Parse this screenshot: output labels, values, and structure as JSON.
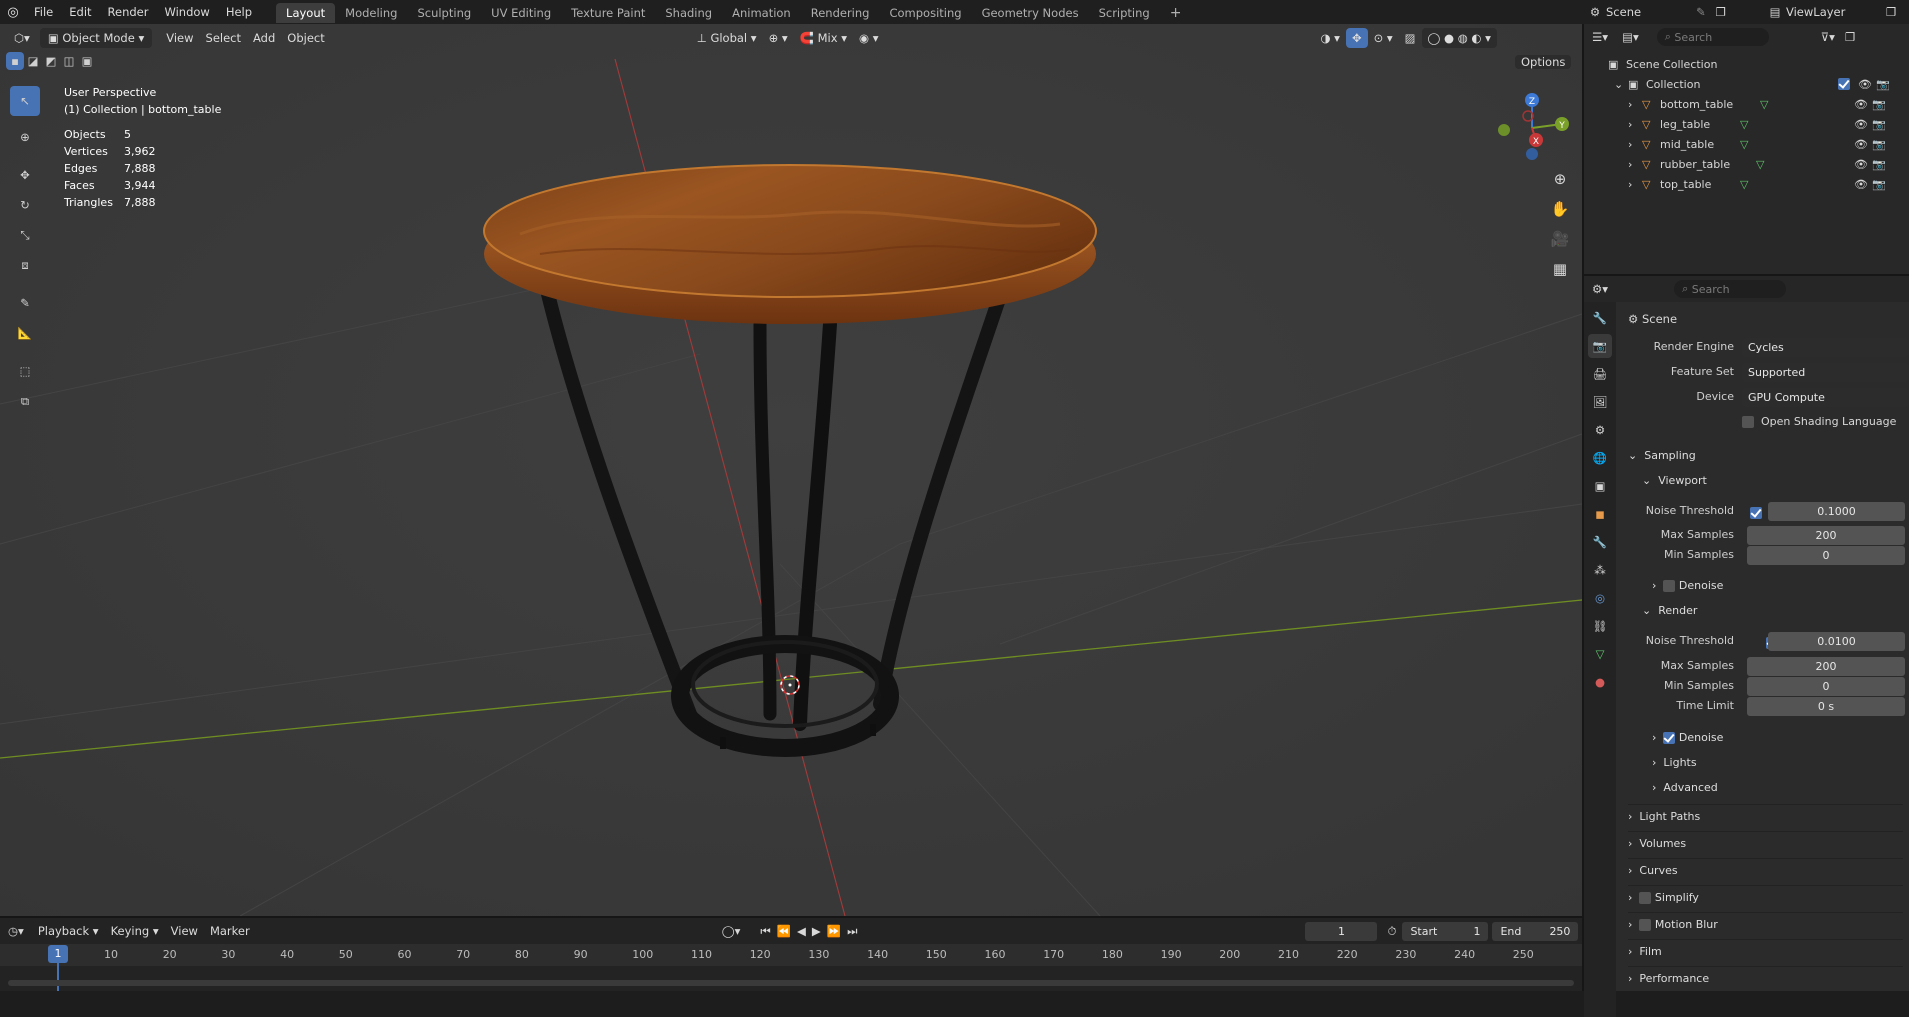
{
  "topbar": {
    "menus": [
      "File",
      "Edit",
      "Render",
      "Window",
      "Help"
    ],
    "workspaces": [
      "Layout",
      "Modeling",
      "Sculpting",
      "UV Editing",
      "Texture Paint",
      "Shading",
      "Animation",
      "Rendering",
      "Compositing",
      "Geometry Nodes",
      "Scripting"
    ],
    "active_workspace": "Layout",
    "add_tab": "+",
    "scene_name": "Scene",
    "view_layer": "ViewLayer"
  },
  "viewport_header": {
    "mode": "Object Mode",
    "menus": [
      "View",
      "Select",
      "Add",
      "Object"
    ],
    "orientation": "Global",
    "snap_mix": "Mix",
    "options": "Options"
  },
  "overlay": {
    "perspective": "User Perspective",
    "collection": "(1) Collection | bottom_table",
    "stats": [
      {
        "label": "Objects",
        "value": "5"
      },
      {
        "label": "Vertices",
        "value": "3,962"
      },
      {
        "label": "Edges",
        "value": "7,888"
      },
      {
        "label": "Faces",
        "value": "3,944"
      },
      {
        "label": "Triangles",
        "value": "7,888"
      }
    ]
  },
  "gizmo": {
    "x": "X",
    "y": "Y",
    "z": "Z"
  },
  "outliner": {
    "search_placeholder": "Search",
    "scene_collection": "Scene Collection",
    "collection": "Collection",
    "objects": [
      "bottom_table",
      "leg_table",
      "mid_table",
      "rubber_table",
      "top_table"
    ]
  },
  "properties": {
    "search_placeholder": "Search",
    "context": "Scene",
    "render_engine_label": "Render Engine",
    "render_engine": "Cycles",
    "feature_set_label": "Feature Set",
    "feature_set": "Supported",
    "device_label": "Device",
    "device": "GPU Compute",
    "osl_label": "Open Shading Language",
    "sampling": "Sampling",
    "viewport": "Viewport",
    "vp_noise_label": "Noise Threshold",
    "vp_noise": "0.1000",
    "vp_max_label": "Max Samples",
    "vp_max": "200",
    "vp_min_label": "Min Samples",
    "vp_min": "0",
    "vp_denoise": "Denoise",
    "render": "Render",
    "r_noise_label": "Noise Threshold",
    "r_noise": "0.0100",
    "r_max_label": "Max Samples",
    "r_max": "200",
    "r_min_label": "Min Samples",
    "r_min": "0",
    "r_time_label": "Time Limit",
    "r_time": "0 s",
    "r_denoise": "Denoise",
    "lights": "Lights",
    "advanced": "Advanced",
    "panels": [
      "Light Paths",
      "Volumes",
      "Curves",
      "Simplify",
      "Motion Blur",
      "Film",
      "Performance"
    ]
  },
  "timeline": {
    "menus": [
      "Playback",
      "Keying",
      "View",
      "Marker"
    ],
    "current_frame": "1",
    "start_label": "Start",
    "start": "1",
    "end_label": "End",
    "end": "250",
    "frames": [
      "10",
      "20",
      "30",
      "40",
      "50",
      "60",
      "70",
      "80",
      "90",
      "100",
      "110",
      "120",
      "130",
      "140",
      "150",
      "160",
      "170",
      "180",
      "190",
      "200",
      "210",
      "220",
      "230",
      "240",
      "250"
    ],
    "playhead": "1"
  },
  "colors": {
    "accent": "#4772b3",
    "wood": "#8a4a1c",
    "metal": "#151515",
    "x_axis": "#b83a3a",
    "y_axis": "#7aa02a"
  }
}
